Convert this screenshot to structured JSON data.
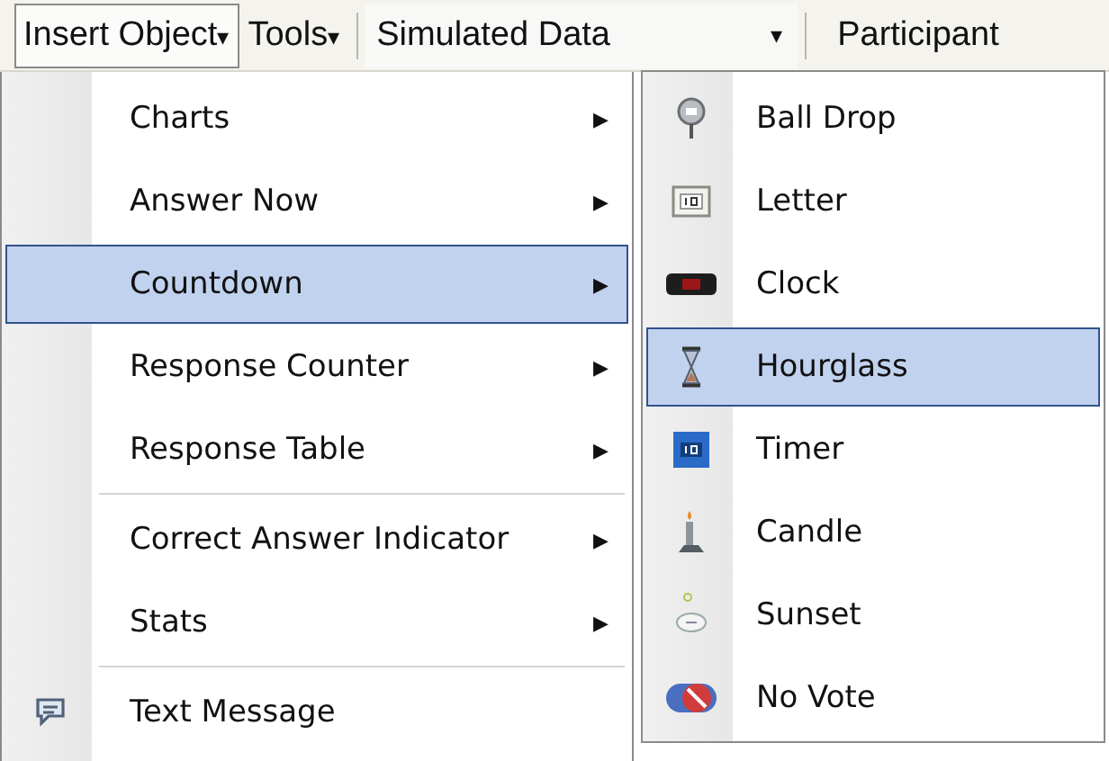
{
  "toolbar": {
    "items": [
      {
        "kind": "menu",
        "label": "Insert Object",
        "caret": "▾",
        "selected": true
      },
      {
        "kind": "menu",
        "label": "Tools",
        "caret": "▾",
        "selected": false
      },
      {
        "kind": "dropdown",
        "value": "Simulated Data",
        "caret": "▾"
      },
      {
        "kind": "menu",
        "label": "Participant",
        "selected": false
      }
    ]
  },
  "menu": {
    "items": [
      {
        "kind": "submenu",
        "label": "Charts",
        "arrow": "▶",
        "selected": false
      },
      {
        "kind": "submenu",
        "label": "Answer Now",
        "arrow": "▶",
        "selected": false
      },
      {
        "kind": "submenu",
        "label": "Countdown",
        "arrow": "▶",
        "selected": true
      },
      {
        "kind": "submenu",
        "label": "Response Counter",
        "arrow": "▶",
        "selected": false
      },
      {
        "kind": "submenu",
        "label": "Response Table",
        "arrow": "▶",
        "selected": false
      },
      {
        "kind": "submenu",
        "label": "Correct Answer Indicator",
        "arrow": "▶",
        "selected": false
      },
      {
        "kind": "submenu",
        "label": "Stats",
        "arrow": "▶",
        "selected": false
      },
      {
        "kind": "command",
        "label": "Text Message",
        "selected": false
      }
    ]
  },
  "submenu": {
    "items": [
      {
        "label": "Ball Drop",
        "selected": false
      },
      {
        "label": "Letter",
        "selected": false
      },
      {
        "label": "Clock",
        "selected": false
      },
      {
        "label": "Hourglass",
        "selected": true
      },
      {
        "label": "Timer",
        "selected": false
      },
      {
        "label": "Candle",
        "selected": false
      },
      {
        "label": "Sunset",
        "selected": false
      },
      {
        "label": "No Vote",
        "selected": false
      }
    ]
  }
}
